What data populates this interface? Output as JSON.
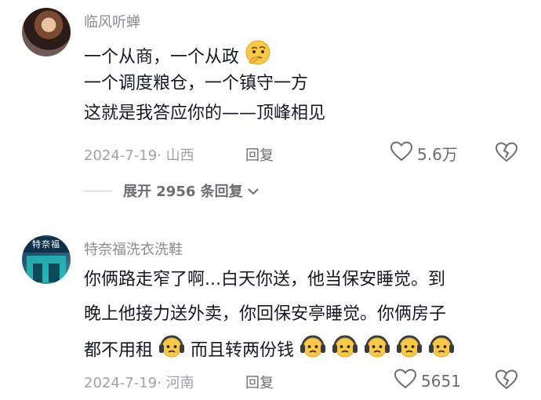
{
  "comments": [
    {
      "username": "临风听蝉",
      "lines": [
        "一个从商，一个从政",
        "一个调度粮仓，一个镇守一方",
        "这就是我答应你的——顶峰相见"
      ],
      "date": "2024-7-19",
      "location": "山西",
      "reply_label": "回复",
      "likes": "5.6万",
      "expand_label": "展开 2956 条回复",
      "emoji_icon": "thinking-emoji"
    },
    {
      "username": "特奈福洗衣洗鞋",
      "avatar_text": "特奈福",
      "lines": [
        "你俩路走窄了啊...白天你送，他当保安睡觉。到",
        "晚上他接力送外卖，你回保安亭睡觉。你俩房子",
        "都不用租",
        "而且转两份钱"
      ],
      "date": "2024-7-19",
      "location": "河南",
      "reply_label": "回复",
      "likes": "5651",
      "emoji_icon": "headphone-sad-emoji"
    }
  ]
}
